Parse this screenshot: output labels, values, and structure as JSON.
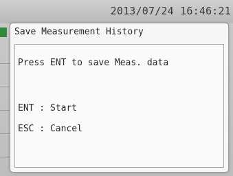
{
  "status_bar": {
    "datetime": "2013/07/24 16:46:21"
  },
  "dialog": {
    "title": "Save Measurement History",
    "message": "Press ENT to save Meas. data",
    "ent_hint": "ENT : Start",
    "esc_hint": "ESC : Cancel"
  },
  "colors": {
    "accent_green": "#2f8a3a"
  }
}
